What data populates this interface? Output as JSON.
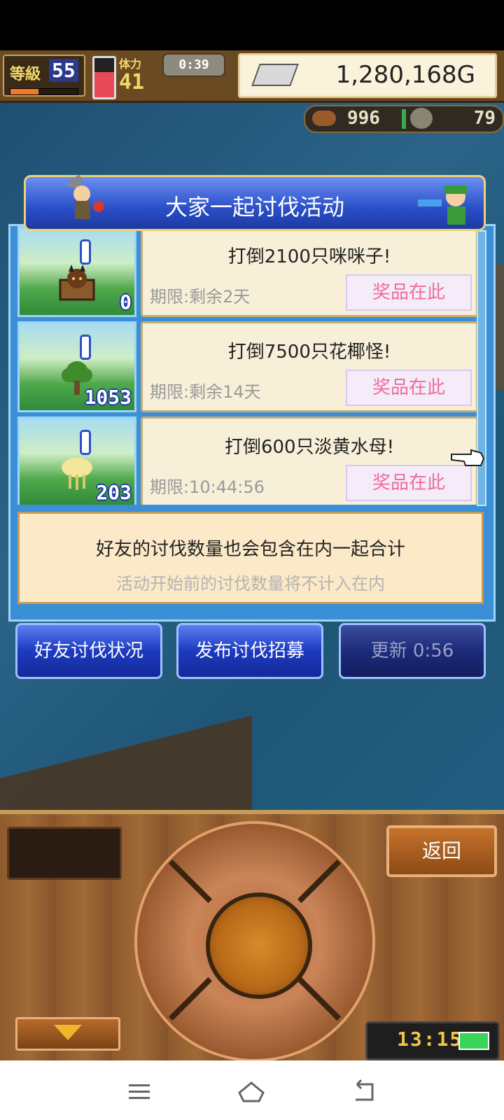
{
  "hud": {
    "level_label": "等級",
    "level_value": "55",
    "level_exp_fraction": 0.42,
    "stamina_label": "体力",
    "stamina_value": "41",
    "stamina_fraction": 0.65,
    "timer": "0:39",
    "money": "1,280,168G",
    "money_icon": "silver-bar-icon",
    "resource_1_icon": "meat-icon",
    "resource_1_value": "996",
    "resource_2_icon": "coin-icon",
    "resource_2_value": "79"
  },
  "dialog": {
    "title": "大家一起讨伐活动",
    "quests": [
      {
        "title": "打倒2100只咪咪子!",
        "deadline": "期限:剩余2天",
        "prize_label": "奖品在此",
        "count": "0",
        "monster_color": "#6a3a1a"
      },
      {
        "title": "打倒7500只花椰怪!",
        "deadline": "期限:剩余14天",
        "prize_label": "奖品在此",
        "count": "1053",
        "monster_color": "#3f8a2a"
      },
      {
        "title": "打倒600只淡黄水母!",
        "deadline": "期限:10:44:56",
        "prize_label": "奖品在此",
        "count": "203",
        "monster_color": "#f2e79a"
      }
    ],
    "info_main": "好友的讨伐数量也会包含在内一起合计",
    "info_sub": "活动开始前的讨伐数量将不计入在内"
  },
  "buttons": {
    "friends_status": "好友讨伐状况",
    "publish_recruit": "发布讨伐招募",
    "refresh": "更新 0:56"
  },
  "panel": {
    "back_label": "返回",
    "clock": "13:15"
  },
  "colors": {
    "accent_blue": "#2a4fc8",
    "prize_pink": "#f06aa0",
    "panel_wood": "#8e5a2e"
  }
}
